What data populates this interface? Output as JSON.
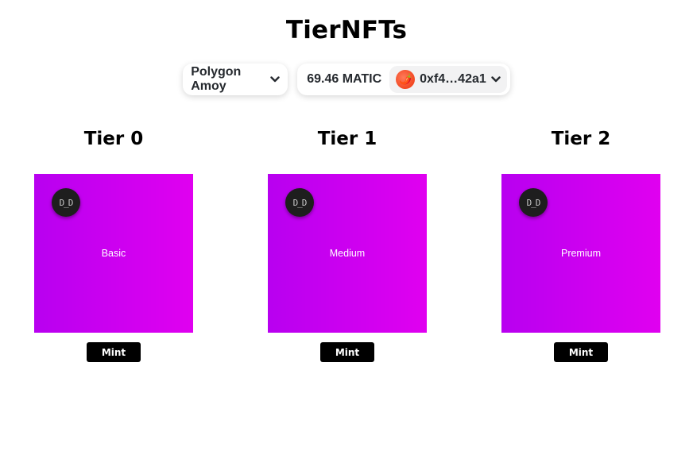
{
  "title": "TierNFTs",
  "wallet": {
    "network": "Polygon Amoy",
    "balance": "69.46 MATIC",
    "address": "0xf4…42a1",
    "avatar_emoji": "🌶️"
  },
  "tiers": [
    {
      "title": "Tier 0",
      "label": "Basic",
      "logo": "D_D",
      "mint": "Mint"
    },
    {
      "title": "Tier 1",
      "label": "Medium",
      "logo": "D_D",
      "mint": "Mint"
    },
    {
      "title": "Tier 2",
      "label": "Premium",
      "logo": "D_D",
      "mint": "Mint"
    }
  ],
  "colors": {
    "card_gradient_start": "#b800f0",
    "card_gradient_end": "#e000f0",
    "mint_button": "#000000"
  },
  "icons": [
    "chevron-down-icon",
    "avatar-icon",
    "logo-badge"
  ]
}
